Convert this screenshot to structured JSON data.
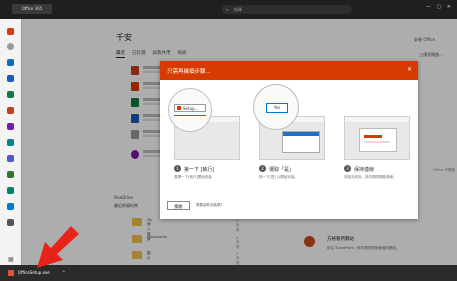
{
  "window": {
    "app_chip": "Office 365",
    "search_text": "搜尋",
    "controls": "— ▢ ✕"
  },
  "main": {
    "title": "千安",
    "tabs": [
      "最近",
      "已釘選",
      "與我共用",
      "探索"
    ],
    "right_link": "安裝 Office",
    "right_link2": "上傳並開啟..."
  },
  "dialog": {
    "title": "只需再幾個步驟...",
    "steps": [
      {
        "num": "1",
        "label": "第一下 [執行]",
        "desc": "選擇一下[執行]開始安裝"
      },
      {
        "num": "2",
        "label": "選取「是」",
        "desc": "按一下[是] 以開始安裝。"
      },
      {
        "num": "3",
        "label": "保持連線",
        "desc": "安裝完成後，請勿關閉網路連線。"
      }
    ],
    "mag1_label": "Setup...",
    "mag2_label": "Yes",
    "close_button": "關閉",
    "help_link": "需要協助安裝嗎?"
  },
  "lower": {
    "onedrive_heading": "OneDrive",
    "onedrive_sub": "最近的資料夾",
    "folders": [
      {
        "name": "My 個人檔案",
        "date": "2月前"
      },
      {
        "name": "Documents",
        "date": "4月前"
      },
      {
        "name": "圖片",
        "date": "3月前"
      }
    ],
    "sp_title": "方格看所關站",
    "sp_desc": "前往 SharePoint，即可看到經常使用的網站。",
    "side_hint": "Office 中開啟"
  },
  "taskbar": {
    "item_label": "OfficeSetup.exe",
    "chevron": "^"
  },
  "colors": {
    "accent": "#d83b01",
    "arrow": "#e8231a"
  },
  "icons": {
    "start": "office-logo-icon",
    "search": "search-icon",
    "close": "close-icon",
    "folder": "folder-icon",
    "sharepoint": "sharepoint-icon",
    "arrow": "red-pointer-arrow"
  }
}
